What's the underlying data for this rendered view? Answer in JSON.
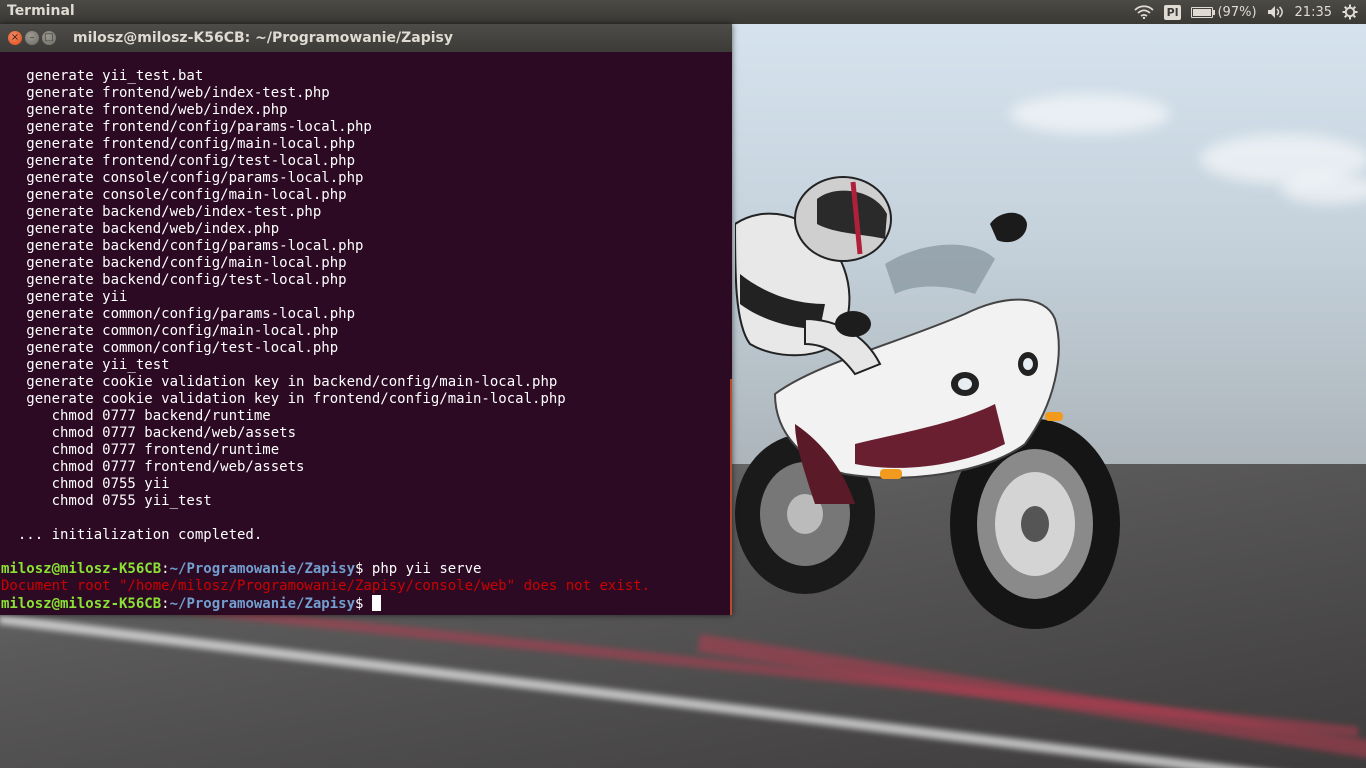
{
  "top_panel": {
    "app_title": "Terminal",
    "indicators": {
      "wifi_icon": "wifi-icon",
      "keyboard_layout": "Pl",
      "battery_percent": "(97%)",
      "battery_level": 0.97,
      "volume_icon": "volume-icon",
      "clock": "21:35",
      "settings_icon": "gear-icon"
    }
  },
  "terminal": {
    "title": "milosz@milosz-K56CB: ~/Programowanie/Zapisy",
    "buttons": {
      "close": "×",
      "minimize": "–",
      "maximize": "□"
    },
    "output_lines": [
      "   generate yii_test.bat",
      "   generate frontend/web/index-test.php",
      "   generate frontend/web/index.php",
      "   generate frontend/config/params-local.php",
      "   generate frontend/config/main-local.php",
      "   generate frontend/config/test-local.php",
      "   generate console/config/params-local.php",
      "   generate console/config/main-local.php",
      "   generate backend/web/index-test.php",
      "   generate backend/web/index.php",
      "   generate backend/config/params-local.php",
      "   generate backend/config/main-local.php",
      "   generate backend/config/test-local.php",
      "   generate yii",
      "   generate common/config/params-local.php",
      "   generate common/config/main-local.php",
      "   generate common/config/test-local.php",
      "   generate yii_test",
      "   generate cookie validation key in backend/config/main-local.php",
      "   generate cookie validation key in frontend/config/main-local.php",
      "      chmod 0777 backend/runtime",
      "      chmod 0777 backend/web/assets",
      "      chmod 0777 frontend/runtime",
      "      chmod 0777 frontend/web/assets",
      "      chmod 0755 yii",
      "      chmod 0755 yii_test",
      "",
      "  ... initialization completed.",
      ""
    ],
    "prompt_user": "milosz@milosz-K56CB",
    "prompt_sep": ":",
    "prompt_path": "~/Programowanie/Zapisy",
    "prompt_dollar": "$ ",
    "command": "php yii serve",
    "error_line": "Document root \"/home/milosz/Programowanie/Zapisy/console/web\" does not exist."
  },
  "colors": {
    "terminal_bg": "#2c0a24",
    "prompt_user": "#8ae234",
    "prompt_path": "#729fcf",
    "error": "#cc0000"
  }
}
